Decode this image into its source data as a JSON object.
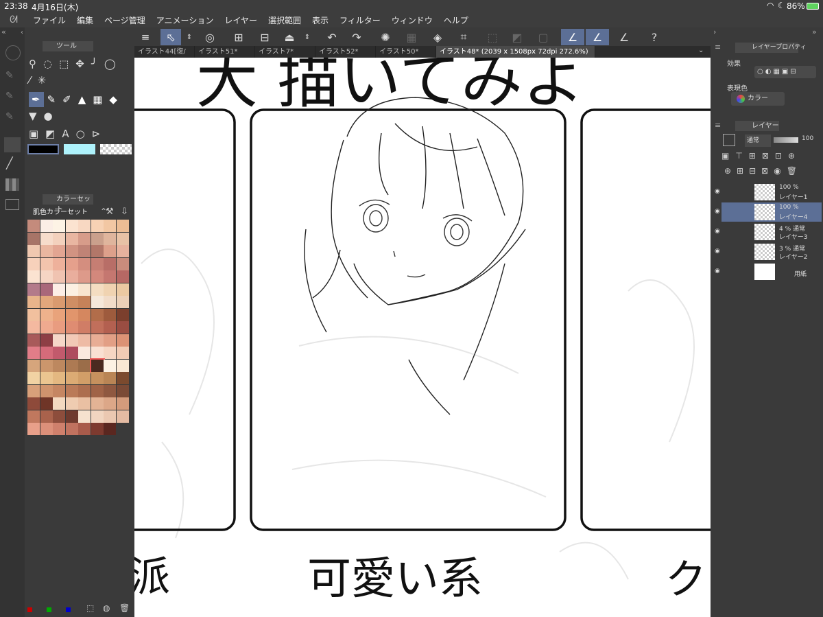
{
  "status": {
    "time": "23:38",
    "date": "4月16日(木)",
    "battery": "86%"
  },
  "menu": [
    "ファイル",
    "編集",
    "ページ管理",
    "アニメーション",
    "レイヤー",
    "選択範囲",
    "表示",
    "フィルター",
    "ウィンドウ",
    "ヘルプ"
  ],
  "tabs": [
    "イラスト44[復/",
    "イラスト51*",
    "イラスト7*",
    "イラスト52*",
    "イラスト50*",
    "イラスト48* (2039 x 1508px 72dpi 272.6%)"
  ],
  "tool_panel": {
    "title": "ツール"
  },
  "color_panel": {
    "title": "カラーセット",
    "set_name": "肌色カラーセット"
  },
  "right": {
    "layer_property_title": "レイヤープロパティ",
    "effect_label": "効果",
    "display_color_label": "表現色",
    "display_color_value": "カラー",
    "layer_panel_title": "レイヤー",
    "blend_mode": "通常",
    "opacity": "100"
  },
  "layers": [
    {
      "pct": "100 %",
      "mode": "",
      "name": "レイヤー1",
      "selected": false
    },
    {
      "pct": "100 %",
      "mode": "",
      "name": "レイヤー4",
      "selected": true
    },
    {
      "pct": "4 %",
      "mode": "通常",
      "name": "レイヤー3",
      "selected": false
    },
    {
      "pct": "3 %",
      "mode": "通常",
      "name": "レイヤー2",
      "selected": false
    },
    {
      "pct": "",
      "mode": "",
      "name": "用紙",
      "selected": false
    }
  ],
  "canvas_text": {
    "top": "大 描いてみよ",
    "left_label": "派",
    "mid_label": "可愛い系",
    "right_label": "ク"
  },
  "colors": {
    "accent": "#5c6f96",
    "fg_color": "#000000",
    "bg_color": "#aef2fb"
  },
  "palette": [
    [
      "#c48b7c",
      "#fbeee6",
      "#fdf3e5",
      "#fbe3d0",
      "#f8d8c2",
      "#f7d2b4",
      "#f2c7a3",
      "#ecbd95"
    ],
    [
      "#a77467",
      "#f6dccb",
      "#f3d1bd",
      "#e9b6a1",
      "#d79c8a",
      "#caa08c",
      "#dfb59d",
      "#e8c2a6"
    ],
    [
      "#f0c8b0",
      "#e9b6a0",
      "#e2a592",
      "#d19382",
      "#c08376",
      "#b27769",
      "#dda08b",
      "#e7b29e"
    ],
    [
      "#f7d1bb",
      "#f3c4ad",
      "#eeb19b",
      "#e5a08c",
      "#d48e7f",
      "#c67e73",
      "#b86e67",
      "#c98c7c"
    ],
    [
      "#fbe3d1",
      "#f6d5c4",
      "#f0c3b1",
      "#e9ae9d",
      "#dd9a8a",
      "#d3887c",
      "#c57770",
      "#b66864"
    ],
    [
      "#b37a8a",
      "#a9677a",
      "#fdeee6",
      "#fcf0e2",
      "#f8e5cf",
      "#f4ddc1",
      "#f0d3b1",
      "#ebc9a2"
    ],
    [
      "#e8b48b",
      "#e2a77c",
      "#d99a6f",
      "#cf8e64",
      "#c58259",
      "#f5e8da",
      "#f1dcc9",
      "#ebd0b8"
    ],
    [
      "#f1c09e",
      "#eeb28c",
      "#e9a37b",
      "#e1956c",
      "#d5875f",
      "#b26d4a",
      "#9e5b3d",
      "#7b3f2d"
    ],
    [
      "#f4b9a0",
      "#efaa8f",
      "#e99c80",
      "#df8c72",
      "#d07d66",
      "#c16f5b",
      "#b36050",
      "#9a4d42"
    ],
    [
      "#a85a5a",
      "#8e3f45",
      "#f6d7c8",
      "#f2c9b6",
      "#eebba5",
      "#e8ad95",
      "#e29f85",
      "#dc9275"
    ],
    [
      "#e27d88",
      "#d56b7a",
      "#c25a6c",
      "#ae4c5e",
      "#fbe9de",
      "#f9e0d2",
      "#f6d6c3",
      "#f2cbb4"
    ],
    [
      "#d6a57c",
      "#cb966c",
      "#bd885f",
      "#ad7a53",
      "#9b6d49",
      "#4a2a20",
      "#fcf2e4",
      "#f9e8d4"
    ],
    [
      "#f1d2a3",
      "#ebc590",
      "#e4b881",
      "#dcab74",
      "#d29e68",
      "#c6915e",
      "#b98555",
      "#7b4a2e"
    ],
    [
      "#d8a07a",
      "#cf936d",
      "#c58662",
      "#ba7a58",
      "#ad6e4f",
      "#a06347",
      "#8f5840",
      "#7a4a36"
    ],
    [
      "#8e4a3a",
      "#6f3527",
      "#f3d9c0",
      "#efccb1",
      "#eac0a3",
      "#e3b395",
      "#dca788",
      "#d39b7c"
    ],
    [
      "#c0785e",
      "#a9624c",
      "#8d4d3c",
      "#6f3a2e",
      "#f6e2cf",
      "#f1d5c0",
      "#ebc8b1",
      "#e4bba3"
    ],
    [
      "#e8a08a",
      "#dc907a",
      "#cf806c",
      "#c0725f",
      "#a85b4b",
      "#7d3a2f",
      "#5a2720",
      "",
      ""
    ]
  ]
}
